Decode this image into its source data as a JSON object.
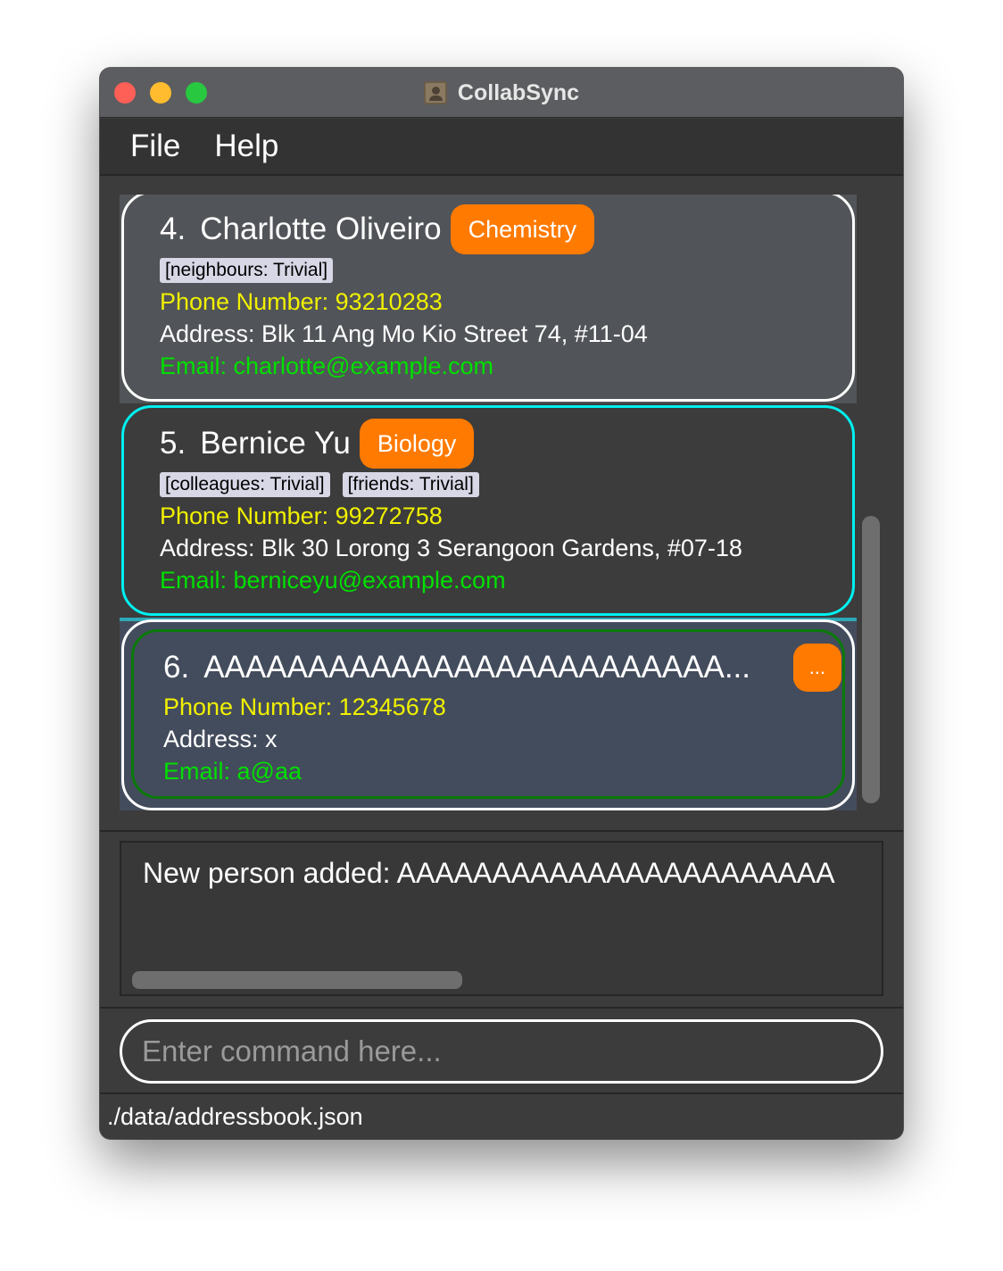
{
  "window": {
    "title": "CollabSync"
  },
  "menu": {
    "file": "File",
    "help": "Help"
  },
  "persons": [
    {
      "index": "4.",
      "name": "Charlotte Oliveiro",
      "badge": "Chemistry",
      "tags": [
        "[neighbours: Trivial]"
      ],
      "phone": "Phone Number: 93210283",
      "address": "Address: Blk 11 Ang Mo Kio Street 74, #11-04",
      "email": "Email: charlotte@example.com"
    },
    {
      "index": "5.",
      "name": "Bernice Yu",
      "badge": "Biology",
      "tags": [
        "[colleagues: Trivial]",
        "[friends: Trivial]"
      ],
      "phone": "Phone Number: 99272758",
      "address": "Address: Blk 30 Lorong 3 Serangoon Gardens, #07-18",
      "email": "Email: berniceyu@example.com"
    },
    {
      "index": "6.",
      "name": "AAAAAAAAAAAAAAAAAAAAAAAAA...",
      "badge": "...",
      "tags": [],
      "phone": "Phone Number: 12345678",
      "address": "Address: x",
      "email": "Email: a@aa"
    }
  ],
  "result": {
    "message": "New person added: AAAAAAAAAAAAAAAAAAAAAAA"
  },
  "command": {
    "placeholder": "Enter command here..."
  },
  "status": {
    "path": "./data/addressbook.json"
  },
  "colors": {
    "selected_border": "#00f0f0",
    "badge": "#ff7a00",
    "phone": "#f0f000",
    "email": "#00e000"
  }
}
